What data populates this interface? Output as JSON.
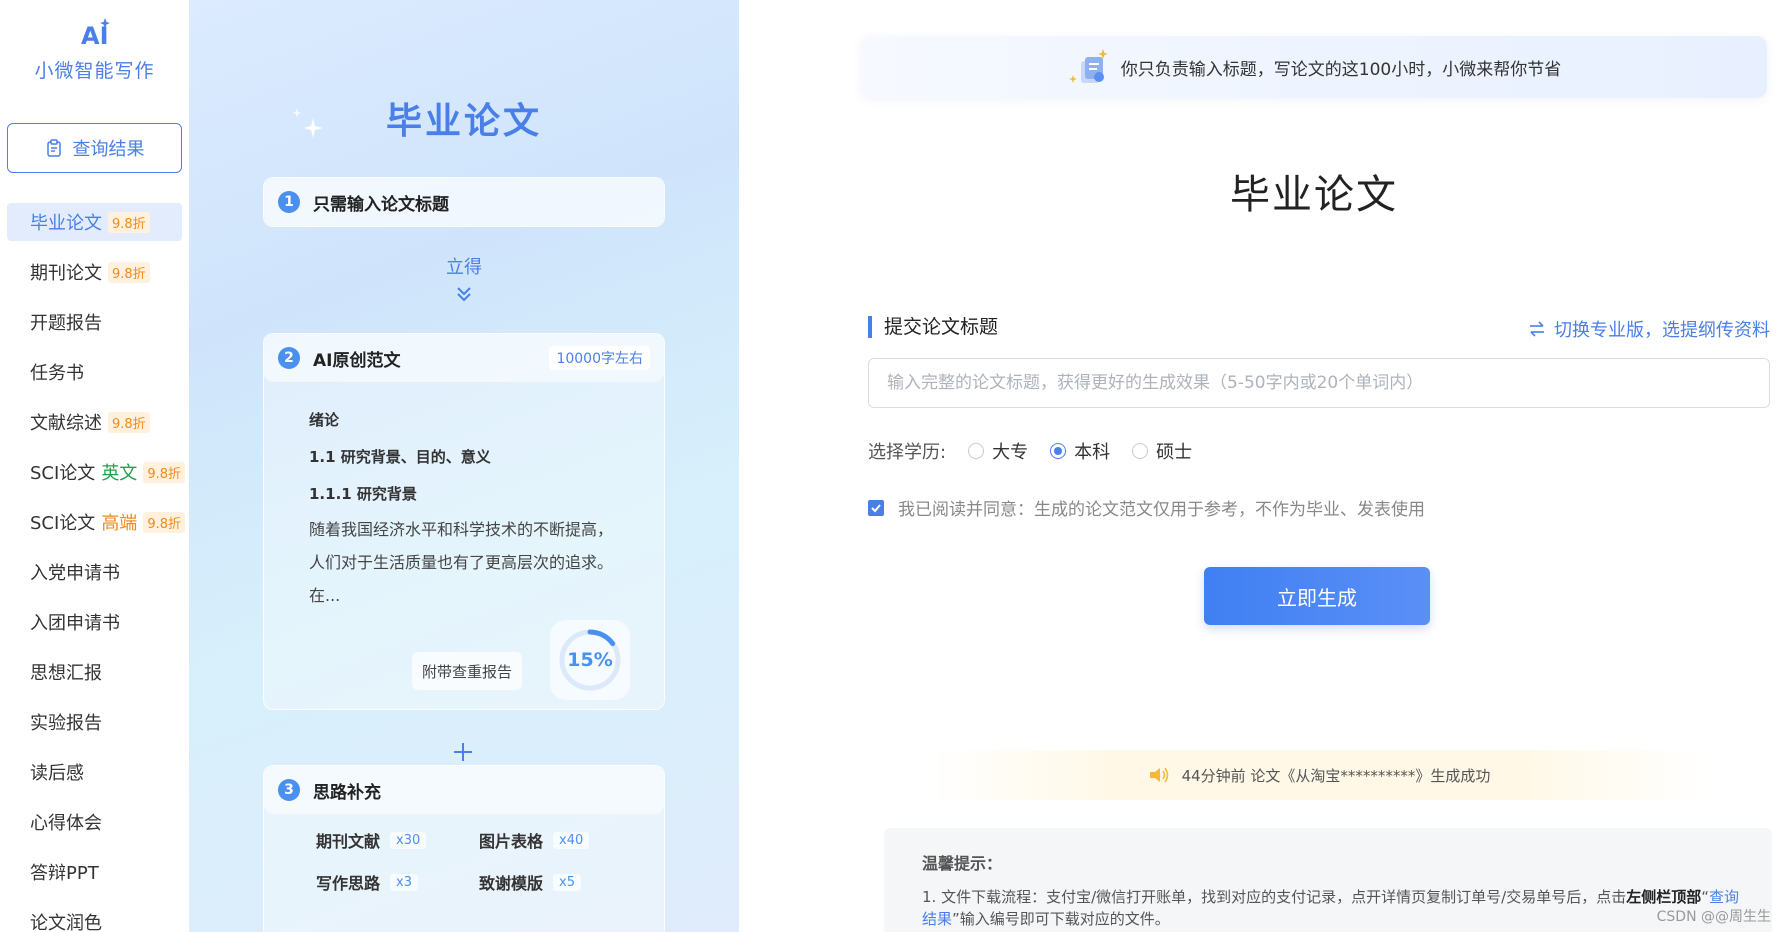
{
  "sidebar": {
    "logo_text": "小微智能写作",
    "query_button": "查询结果",
    "items": [
      {
        "label": "毕业论文",
        "badge": "9.8折"
      },
      {
        "label": "期刊论文",
        "badge": "9.8折"
      },
      {
        "label": "开题报告"
      },
      {
        "label": "任务书"
      },
      {
        "label": "文献综述",
        "badge": "9.8折"
      },
      {
        "label": "SCI论文",
        "tag": "英文",
        "badge": "9.8折"
      },
      {
        "label": "SCI论文",
        "tag": "高端",
        "badge": "9.8折"
      },
      {
        "label": "入党申请书"
      },
      {
        "label": "入团申请书"
      },
      {
        "label": "思想汇报"
      },
      {
        "label": "实验报告"
      },
      {
        "label": "读后感"
      },
      {
        "label": "心得体会"
      },
      {
        "label": "答辩PPT"
      },
      {
        "label": "论文润色"
      }
    ]
  },
  "promo": {
    "title": "毕业论文",
    "step1": {
      "num": "1",
      "label": "只需输入论文标题"
    },
    "arrow_text": "立得",
    "step2": {
      "num": "2",
      "label": "AI原创范文",
      "badge": "10000字左右",
      "essay_heading1": "绪论",
      "essay_heading2": "1.1 研究背景、目的、意义",
      "essay_heading3": "1.1.1 研究背景",
      "essay_line1": "随着我国经济水平和科学技术的不断提高，",
      "essay_line2": "人们对于生活质量也有了更高层次的追求。",
      "essay_line3": "在...",
      "report_tag": "附带查重报告",
      "report_percent": "15%",
      "report_value": 0.15
    },
    "step3": {
      "num": "3",
      "label": "思路补充",
      "items": [
        {
          "label": "期刊文献",
          "mult": "x30"
        },
        {
          "label": "图片表格",
          "mult": "x40"
        },
        {
          "label": "写作思路",
          "mult": "x3"
        },
        {
          "label": "致谢模版",
          "mult": "x5"
        }
      ]
    }
  },
  "main": {
    "banner": "你只负责输入标题，写论文的这100小时，小微来帮你节省",
    "title": "毕业论文",
    "section_label": "提交论文标题",
    "switch_link": "切换专业版，选提纲传资料",
    "input_placeholder": "输入完整的论文标题，获得更好的生成效果（5-50字内或20个单词内）",
    "input_value": "",
    "edu_label": "选择学历:",
    "edu_options": [
      "大专",
      "本科",
      "硕士"
    ],
    "edu_selected": "本科",
    "agree_text": "我已阅读并同意：生成的论文范文仅用于参考，不作为毕业、发表使用",
    "agree_checked": true,
    "generate_button": "立即生成",
    "notice": "44分钟前 论文《从淘宝**********》生成成功",
    "tips_title": "温馨提示：",
    "tips_text_1": "1. 文件下载流程：支付宝/微信打开账单，找到对应的支付记录，点开详情页复制订单号/交易单号后，点击",
    "tips_bold": "左侧栏顶部",
    "tips_quote_open": "“",
    "tips_link": "查询结果",
    "tips_text_2": "”输入编号即可下载对应的文件。",
    "watermark": "CSDN @@周生生"
  },
  "colors": {
    "accent": "#4a7fe8",
    "badge_orange": "#f08a1c",
    "english_green": "#22a04a"
  }
}
